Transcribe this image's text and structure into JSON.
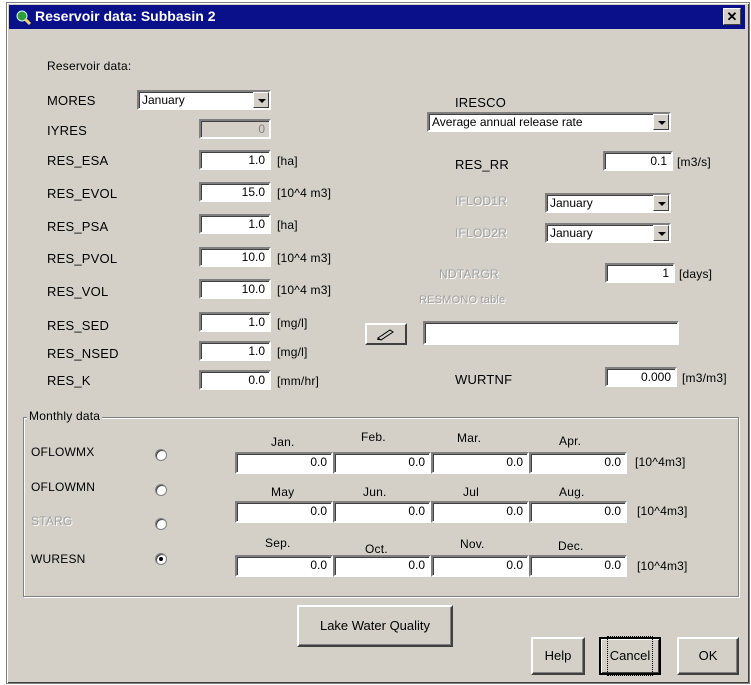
{
  "window": {
    "title": "Reservoir data: Subbasin 2",
    "close_glyph": "✕"
  },
  "reservoir": {
    "section_label": "Reservoir data:",
    "mores": {
      "label": "MORES",
      "value": "January"
    },
    "fields": [
      {
        "label": "IYRES",
        "value": "0",
        "unit": ""
      },
      {
        "label": "RES_ESA",
        "value": "1.0",
        "unit": "[ha]"
      },
      {
        "label": "RES_EVOL",
        "value": "15.0",
        "unit": "[10^4 m3]"
      },
      {
        "label": "RES_PSA",
        "value": "1.0",
        "unit": "[ha]"
      },
      {
        "label": "RES_PVOL",
        "value": "10.0",
        "unit": "[10^4 m3]"
      },
      {
        "label": "RES_VOL",
        "value": "10.0",
        "unit": "[10^4 m3]"
      },
      {
        "label": "RES_SED",
        "value": "1.0",
        "unit": "[mg/l]"
      },
      {
        "label": "RES_NSED",
        "value": "1.0",
        "unit": "[mg/l]"
      },
      {
        "label": "RES_K",
        "value": "0.0",
        "unit": "[mm/hr]"
      }
    ]
  },
  "right": {
    "iresco": {
      "label": "IRESCO",
      "value": "Average annual release rate"
    },
    "res_rr": {
      "label": "RES_RR",
      "value": "0.1",
      "unit": "[m3/s]"
    },
    "iflod1r": {
      "label": "IFLOD1R",
      "value": "January"
    },
    "iflod2r": {
      "label": "IFLOD2R",
      "value": "January"
    },
    "ndtargr": {
      "label": "NDTARGR",
      "value": "1",
      "unit": "[days]"
    },
    "resmono": {
      "label": "RESMONO table",
      "value": ""
    },
    "wurtnf": {
      "label": "WURTNF",
      "value": "0.000",
      "unit": "[m3/m3]"
    }
  },
  "monthly": {
    "section_label": "Monthly data",
    "radios": [
      {
        "label": "OFLOWMX",
        "selected": false,
        "disabled": false
      },
      {
        "label": "OFLOWMN",
        "selected": false,
        "disabled": false
      },
      {
        "label": "STARG",
        "selected": false,
        "disabled": true
      },
      {
        "label": "WURESN",
        "selected": true,
        "disabled": false
      }
    ],
    "rows": [
      {
        "months": [
          "Jan.",
          "Feb.",
          "Mar.",
          "Apr."
        ],
        "values": [
          "0.0",
          "0.0",
          "0.0",
          "0.0"
        ],
        "unit": "[10^4m3]"
      },
      {
        "months": [
          "May",
          "Jun.",
          "Jul",
          "Aug."
        ],
        "values": [
          "0.0",
          "0.0",
          "0.0",
          "0.0"
        ],
        "unit": "[10^4m3]"
      },
      {
        "months": [
          "Sep.",
          "Oct.",
          "Nov.",
          "Dec."
        ],
        "values": [
          "0.0",
          "0.0",
          "0.0",
          "0.0"
        ],
        "unit": "[10^4m3]"
      }
    ]
  },
  "buttons": {
    "lake_quality": "Lake Water Quality",
    "help": "Help",
    "cancel": "Cancel",
    "ok": "OK"
  }
}
